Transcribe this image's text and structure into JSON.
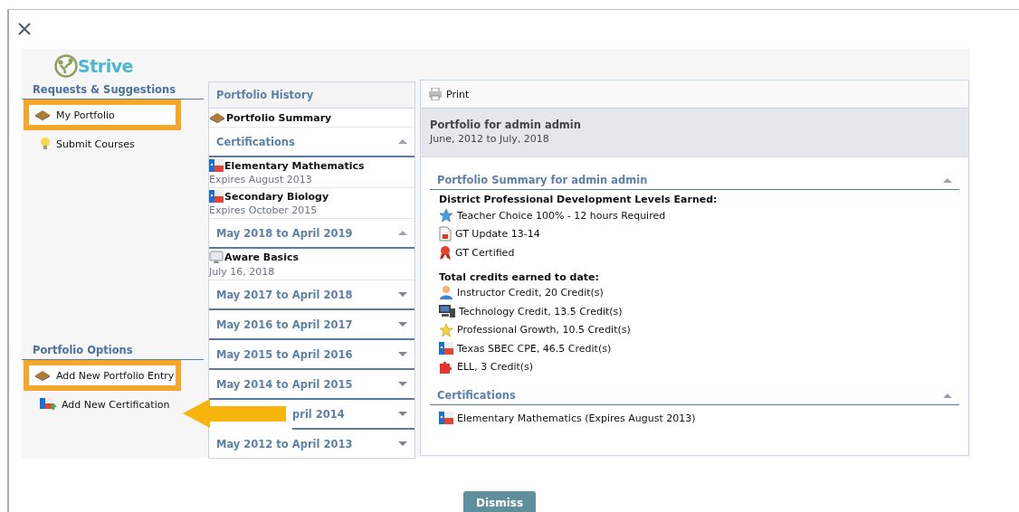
{
  "logo": {
    "text": "Strive"
  },
  "sidebar": {
    "groups": [
      {
        "title": "Requests & Suggestions",
        "items": [
          {
            "label": "My Portfolio",
            "kind": "book",
            "highlighted": true
          },
          {
            "label": "Submit Courses",
            "kind": "bulb",
            "highlighted": false
          }
        ]
      },
      {
        "title": "Portfolio Options",
        "items": [
          {
            "label": "Add New Portfolio Entry",
            "kind": "book",
            "highlighted": true
          },
          {
            "label": "Add New Certification",
            "kind": "flagplus",
            "highlighted": false
          }
        ]
      }
    ]
  },
  "history": {
    "title": "Portfolio History",
    "summary": "Portfolio Summary",
    "sections": [
      {
        "title": "Certifications",
        "expanded": true,
        "obscured": false,
        "entries": [
          {
            "title": "Elementary Mathematics",
            "subtitle": "Expires August 2013",
            "kind": "flag"
          },
          {
            "title": "Secondary Biology",
            "subtitle": "Expires October 2015",
            "kind": "flag"
          }
        ]
      },
      {
        "title": "May 2018 to April 2019",
        "expanded": true,
        "obscured": false,
        "entries": [
          {
            "title": "Aware Basics",
            "subtitle": "July 16, 2018",
            "kind": "monitor"
          }
        ]
      },
      {
        "title": "May 2017 to April 2018",
        "expanded": false,
        "obscured": false
      },
      {
        "title": "May 2016 to April 2017",
        "expanded": false,
        "obscured": false
      },
      {
        "title": "May 2015 to April 2016",
        "expanded": false,
        "obscured": false
      },
      {
        "title": "May 2014 to April 2015",
        "expanded": false,
        "obscured": false
      },
      {
        "title": "pril 2014",
        "expanded": false,
        "obscured": true
      },
      {
        "title": "May 2012 to April 2013",
        "expanded": false,
        "obscured": false
      }
    ]
  },
  "report": {
    "print": "Print",
    "title": "Portfolio for admin admin",
    "range": "June, 2012 to July, 2018",
    "sections": [
      {
        "title": "Portfolio Summary for admin admin",
        "expanded": true,
        "groups": [
          {
            "heading": "District Professional Development Levels Earned:",
            "items": [
              {
                "label": "Teacher Choice 100% - 12 hours Required",
                "kind": "bluestar"
              },
              {
                "label": "GT Update 13-14",
                "kind": "document"
              },
              {
                "label": "GT Certified",
                "kind": "ribbon"
              }
            ]
          },
          {
            "heading": "Total credits earned to date:",
            "items": [
              {
                "label": "Instructor Credit, 20 Credit(s)",
                "kind": "person"
              },
              {
                "label": "Technology Credit, 13.5 Credit(s)",
                "kind": "computer"
              },
              {
                "label": "Professional Growth, 10.5 Credit(s)",
                "kind": "goldstar"
              },
              {
                "label": "Texas SBEC CPE, 46.5 Credit(s)",
                "kind": "flag"
              },
              {
                "label": "ELL, 3 Credit(s)",
                "kind": "puzzle"
              }
            ]
          }
        ]
      },
      {
        "title": "Certifications",
        "expanded": true,
        "groups": [
          {
            "items": [
              {
                "label": "Elementary Mathematics (Expires August 2013)",
                "kind": "flag"
              }
            ]
          }
        ]
      }
    ]
  },
  "dismiss": "Dismiss"
}
